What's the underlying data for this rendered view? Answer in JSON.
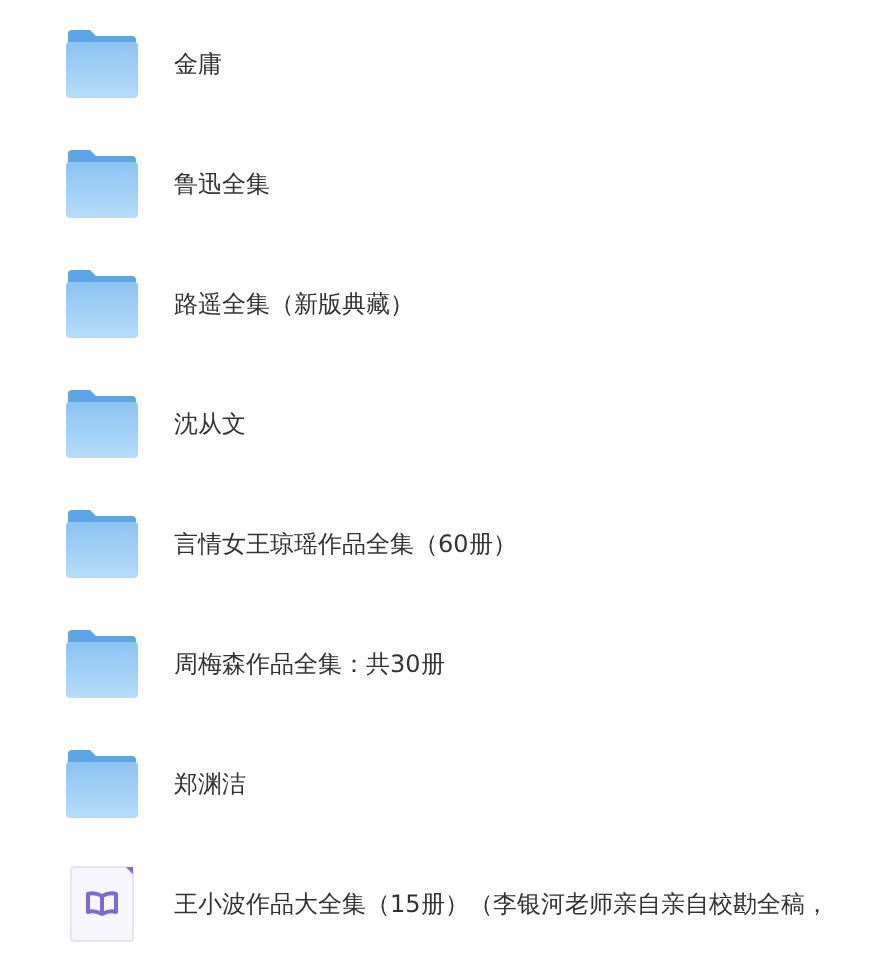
{
  "files": [
    {
      "kind": "folder",
      "name": "金庸"
    },
    {
      "kind": "folder",
      "name": "鲁迅全集"
    },
    {
      "kind": "folder",
      "name": "路遥全集（新版典藏）"
    },
    {
      "kind": "folder",
      "name": "沈从文"
    },
    {
      "kind": "folder",
      "name": "言情女王琼瑶作品全集（60册）"
    },
    {
      "kind": "folder",
      "name": "周梅森作品全集：共30册"
    },
    {
      "kind": "folder",
      "name": "郑渊洁"
    },
    {
      "kind": "ebook",
      "name": "王小波作品大全集（15册）（李银河老师亲自亲自校勘全稿，"
    }
  ]
}
